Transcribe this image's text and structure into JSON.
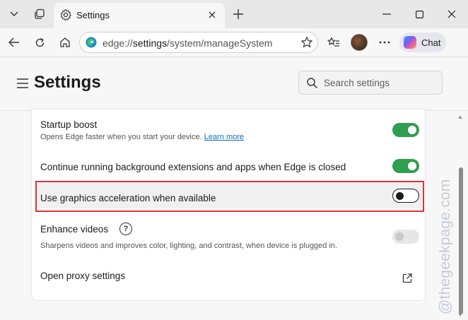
{
  "tab": {
    "title": "Settings",
    "icon": "gear-icon"
  },
  "address": {
    "prefix": "edge://",
    "path": "settings",
    "rest": "/system/manageSystem"
  },
  "toolbar": {
    "chat_label": "Chat"
  },
  "page": {
    "title": "Settings",
    "search_placeholder": "Search settings"
  },
  "settings": [
    {
      "title": "Startup boost",
      "description": "Opens Edge faster when you start your device.",
      "link": "Learn more",
      "state": "on"
    },
    {
      "title": "Continue running background extensions and apps when Edge is closed",
      "state": "on"
    },
    {
      "title": "Use graphics acceleration when available",
      "state": "off",
      "highlighted": true
    },
    {
      "title": "Enhance videos",
      "description": "Sharpens videos and improves color, lighting, and contrast, when device is plugged in.",
      "state": "disabled"
    },
    {
      "title": "Open proxy settings",
      "action": "external-link"
    }
  ],
  "watermark": "@thegeekpage.com",
  "colors": {
    "toggle_on": "#2e9e4f",
    "highlight_border": "#e0323a",
    "link": "#0f6cbd"
  }
}
